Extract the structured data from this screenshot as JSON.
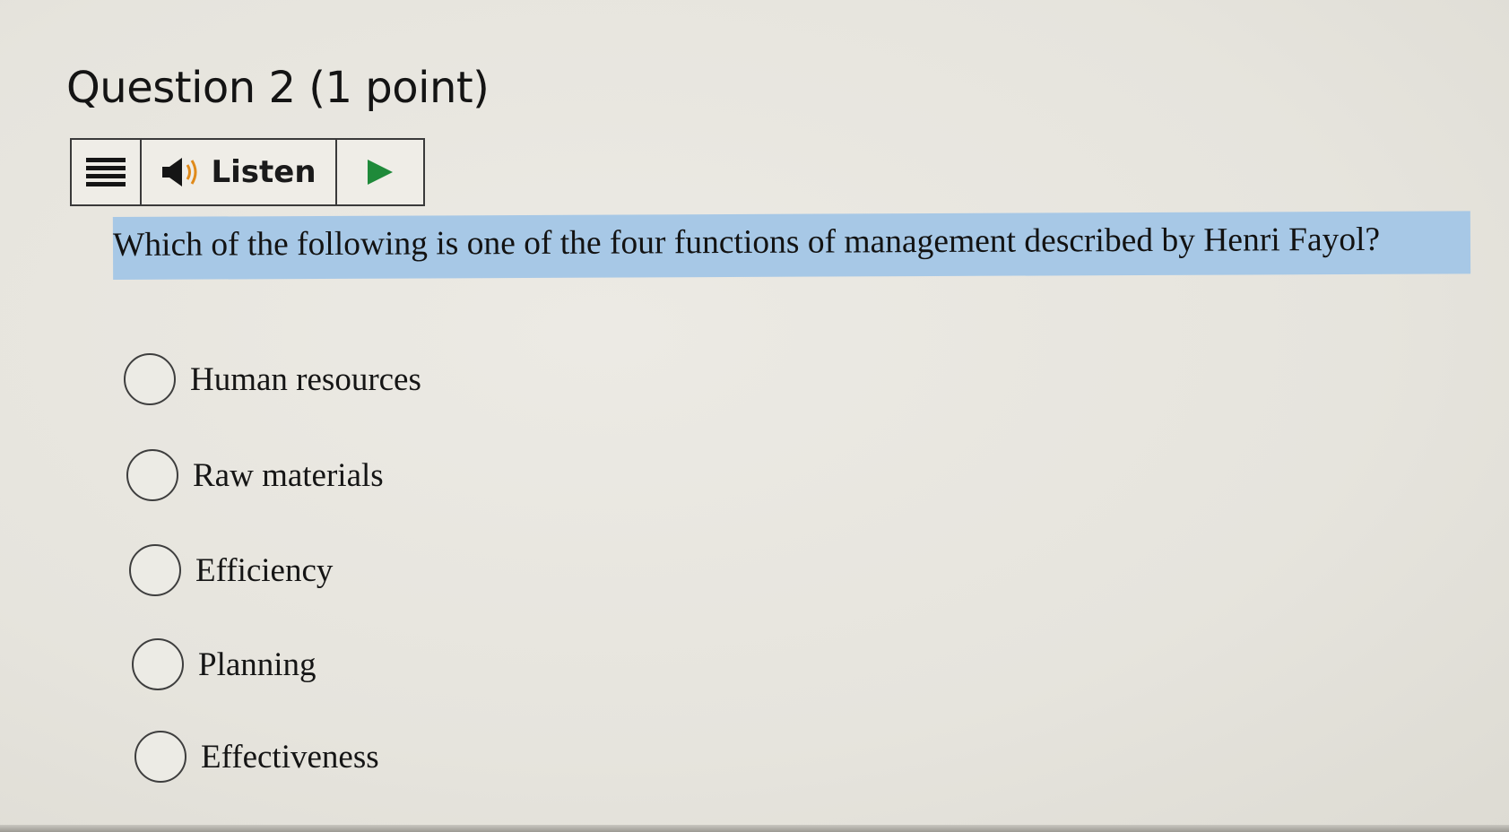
{
  "question": {
    "heading": "Question 2 (1 point)",
    "text": "Which of the following is one of the four functions of management described by Henri Fayol?"
  },
  "listen_bar": {
    "menu_icon": "menu-icon",
    "speaker_icon": "speaker-icon",
    "label": "Listen",
    "play_icon": "play-icon"
  },
  "options": [
    {
      "label": "Human resources",
      "selected": false
    },
    {
      "label": "Raw materials",
      "selected": false
    },
    {
      "label": "Efficiency",
      "selected": false
    },
    {
      "label": "Planning",
      "selected": false
    },
    {
      "label": "Effectiveness",
      "selected": false
    }
  ],
  "colors": {
    "highlight": "#a7c8e6",
    "play": "#1f8a3a",
    "background": "#e8e6df"
  }
}
